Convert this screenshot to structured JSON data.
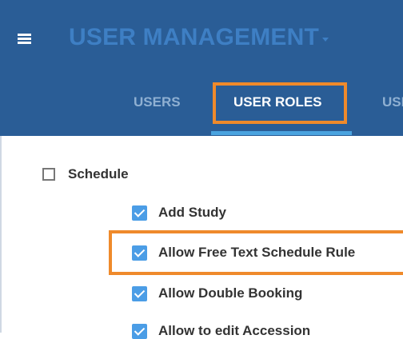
{
  "header": {
    "menu_icon": "hamburger-menu-icon",
    "title": "USER MANAGEMENT",
    "title_caret_icon": "caret-down-icon",
    "background_color": "#2a5d96"
  },
  "tabs": [
    {
      "label": "USERS",
      "active": false
    },
    {
      "label": "USER ROLES",
      "active": true
    },
    {
      "label": "USI",
      "active": false
    }
  ],
  "permissions": {
    "group": {
      "label": "Schedule",
      "checked": false
    },
    "items": [
      {
        "label": "Add Study",
        "checked": true
      },
      {
        "label": "Allow Free Text Schedule Rule",
        "checked": true
      },
      {
        "label": "Allow Double Booking",
        "checked": true
      },
      {
        "label": "Allow to edit Accession",
        "checked": true
      }
    ]
  },
  "colors": {
    "accent": "#4b9de6",
    "highlight": "#ef8a2b",
    "tab_underline": "#4aa3df"
  }
}
